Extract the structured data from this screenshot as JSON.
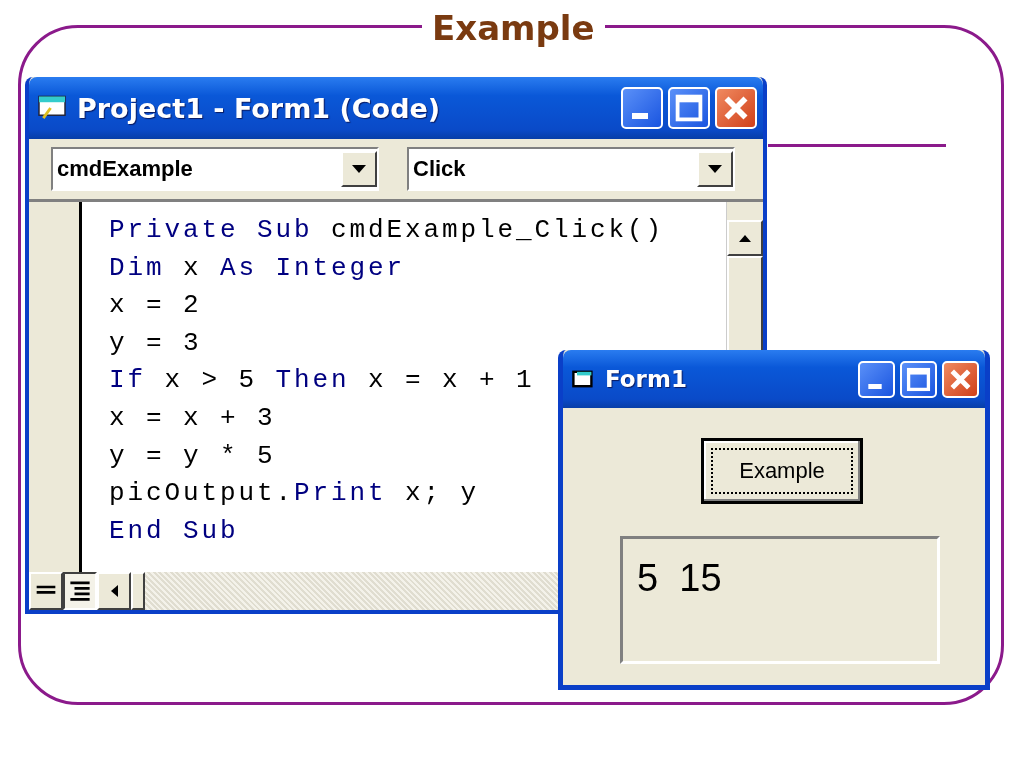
{
  "slide": {
    "title": "Example"
  },
  "code_window": {
    "title": "Project1 - Form1 (Code)",
    "object_combo": "cmdExample",
    "procedure_combo": "Click",
    "lines": [
      [
        {
          "text": "Private Sub",
          "kind": "keyword"
        },
        {
          "text": " cmdExample_Click()",
          "kind": "plain"
        }
      ],
      [
        {
          "text": "Dim",
          "kind": "keyword"
        },
        {
          "text": " x ",
          "kind": "plain"
        },
        {
          "text": "As Integer",
          "kind": "keyword"
        }
      ],
      [
        {
          "text": "x = 2",
          "kind": "plain"
        }
      ],
      [
        {
          "text": "y = 3",
          "kind": "plain"
        }
      ],
      [
        {
          "text": "If",
          "kind": "keyword"
        },
        {
          "text": " x > 5 ",
          "kind": "plain"
        },
        {
          "text": "Then",
          "kind": "keyword"
        },
        {
          "text": " x = x + 1",
          "kind": "plain"
        }
      ],
      [
        {
          "text": "x = x + 3",
          "kind": "plain"
        }
      ],
      [
        {
          "text": "y = y * 5",
          "kind": "plain"
        }
      ],
      [
        {
          "text": "picOutput.",
          "kind": "plain"
        },
        {
          "text": "Print",
          "kind": "keyword"
        },
        {
          "text": " x; y",
          "kind": "plain"
        }
      ],
      [
        {
          "text": "End Sub",
          "kind": "keyword"
        }
      ]
    ]
  },
  "form_window": {
    "title": "Form1",
    "button": "Example",
    "output": "5  15"
  }
}
